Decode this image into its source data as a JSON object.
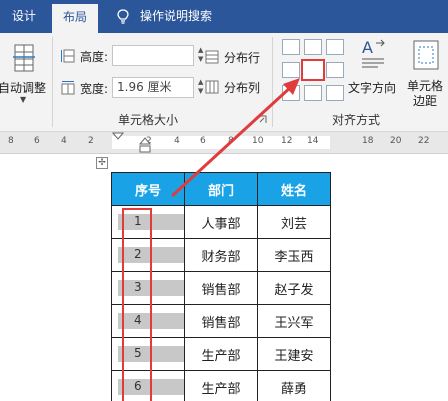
{
  "tabs": {
    "design": "设计",
    "layout": "布局",
    "help": "操作说明搜索"
  },
  "ribbon": {
    "autofit_label": "自动调整",
    "height_label": "高度:",
    "height_value": "",
    "width_label": "宽度:",
    "width_value": "1.96 厘米",
    "distribute_rows": "分布行",
    "distribute_cols": "分布列",
    "cell_size_group": "单元格大小",
    "text_direction": "文字方向",
    "cell_margins": "单元格\n边距",
    "alignment_group": "对齐方式"
  },
  "ruler": [
    "8",
    "6",
    "4",
    "2",
    "2",
    "4",
    "6",
    "8",
    "10",
    "12",
    "14",
    "18",
    "20",
    "22"
  ],
  "table": {
    "headers": [
      "序号",
      "部门",
      "姓名"
    ],
    "rows": [
      [
        "1",
        "人事部",
        "刘芸"
      ],
      [
        "2",
        "财务部",
        "李玉西"
      ],
      [
        "3",
        "销售部",
        "赵子发"
      ],
      [
        "4",
        "销售部",
        "王兴军"
      ],
      [
        "5",
        "生产部",
        "王建安"
      ],
      [
        "6",
        "生产部",
        "薛勇"
      ]
    ]
  },
  "colors": {
    "tabbar": "#2b579a",
    "header_fill": "#19a3e6",
    "highlight": "#e03c3c"
  }
}
